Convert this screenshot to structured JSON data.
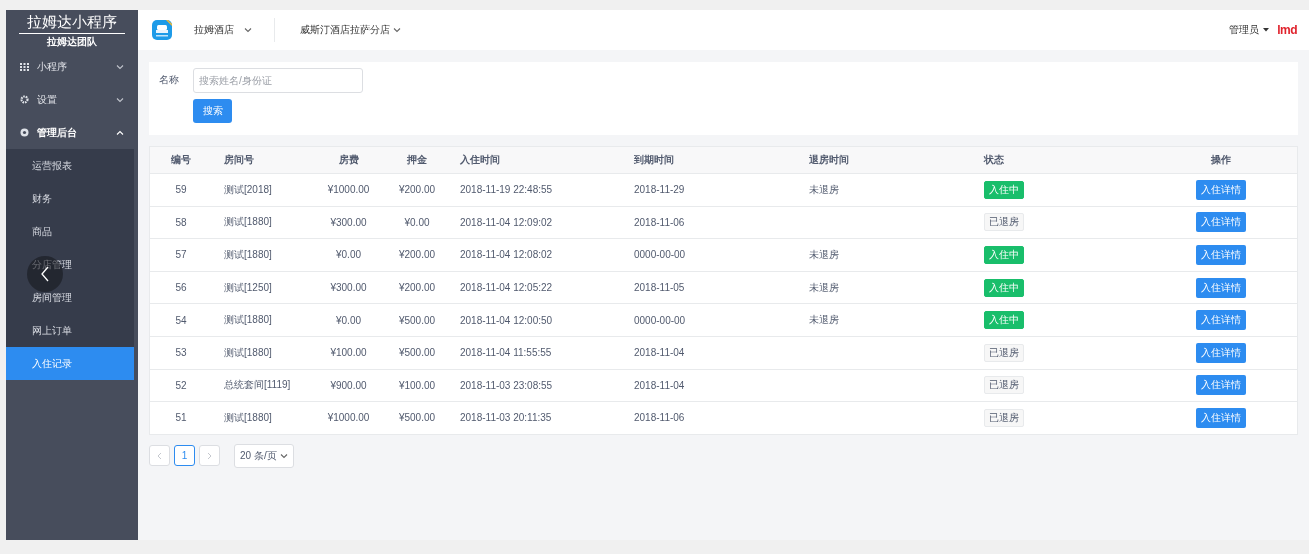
{
  "sidebar": {
    "title": "拉姆达小程序",
    "subtitle": "拉姆达团队",
    "menu": [
      {
        "label": "小程序",
        "expanded": false
      },
      {
        "label": "设置",
        "expanded": false
      },
      {
        "label": "管理后台",
        "expanded": true,
        "children": [
          {
            "label": "运营报表",
            "selected": false
          },
          {
            "label": "财务",
            "selected": false
          },
          {
            "label": "商品",
            "selected": false
          },
          {
            "label": "分店管理",
            "selected": false
          },
          {
            "label": "房间管理",
            "selected": false
          },
          {
            "label": "网上订单",
            "selected": false
          },
          {
            "label": "入住记录",
            "selected": true
          }
        ]
      }
    ]
  },
  "header": {
    "hotel": "拉姆酒店",
    "branch": "威斯汀酒店拉萨分店",
    "user": "管理员",
    "brand": "lmd"
  },
  "search": {
    "label": "名称",
    "placeholder": "搜索姓名/身份证",
    "button": "搜索"
  },
  "table": {
    "columns": [
      "编号",
      "房间号",
      "房费",
      "押金",
      "入住时间",
      "到期时间",
      "退房时间",
      "状态",
      "操作"
    ],
    "rows": [
      {
        "id": "59",
        "room": "测试[2018]",
        "fee": "¥1000.00",
        "deposit": "¥200.00",
        "checkin": "2018-11-19 22:48:55",
        "due": "2018-11-29",
        "checkout": "未退房",
        "status": {
          "kind": "in",
          "label": "入住中"
        },
        "action": "入住详情"
      },
      {
        "id": "58",
        "room": "测试[1880]",
        "fee": "¥300.00",
        "deposit": "¥0.00",
        "checkin": "2018-11-04 12:09:02",
        "due": "2018-11-06",
        "status": {
          "kind": "out",
          "label": "已退房"
        },
        "action": "入住详情"
      },
      {
        "id": "57",
        "room": "测试[1880]",
        "fee": "¥0.00",
        "deposit": "¥200.00",
        "checkin": "2018-11-04 12:08:02",
        "due": "0000-00-00",
        "checkout": "未退房",
        "status": {
          "kind": "in",
          "label": "入住中"
        },
        "action": "入住详情"
      },
      {
        "id": "56",
        "room": "测试[1250]",
        "fee": "¥300.00",
        "deposit": "¥200.00",
        "checkin": "2018-11-04 12:05:22",
        "due": "2018-11-05",
        "checkout": "未退房",
        "status": {
          "kind": "in",
          "label": "入住中"
        },
        "action": "入住详情"
      },
      {
        "id": "54",
        "room": "测试[1880]",
        "fee": "¥0.00",
        "deposit": "¥500.00",
        "checkin": "2018-11-04 12:00:50",
        "due": "0000-00-00",
        "checkout": "未退房",
        "status": {
          "kind": "in",
          "label": "入住中"
        },
        "action": "入住详情"
      },
      {
        "id": "53",
        "room": "测试[1880]",
        "fee": "¥100.00",
        "deposit": "¥500.00",
        "checkin": "2018-11-04 11:55:55",
        "due": "2018-11-04",
        "status": {
          "kind": "out",
          "label": "已退房"
        },
        "action": "入住详情"
      },
      {
        "id": "52",
        "room": "总统套间[1119]",
        "fee": "¥900.00",
        "deposit": "¥100.00",
        "checkin": "2018-11-03 23:08:55",
        "due": "2018-11-04",
        "status": {
          "kind": "out",
          "label": "已退房"
        },
        "action": "入住详情"
      },
      {
        "id": "51",
        "room": "测试[1880]",
        "fee": "¥1000.00",
        "deposit": "¥500.00",
        "checkin": "2018-11-03 20:11:35",
        "due": "2018-11-06",
        "status": {
          "kind": "out",
          "label": "已退房"
        },
        "action": "入住详情"
      }
    ]
  },
  "pagination": {
    "pages": [
      {
        "label": "1",
        "selected": true
      }
    ],
    "page_size": "20 条/页"
  }
}
